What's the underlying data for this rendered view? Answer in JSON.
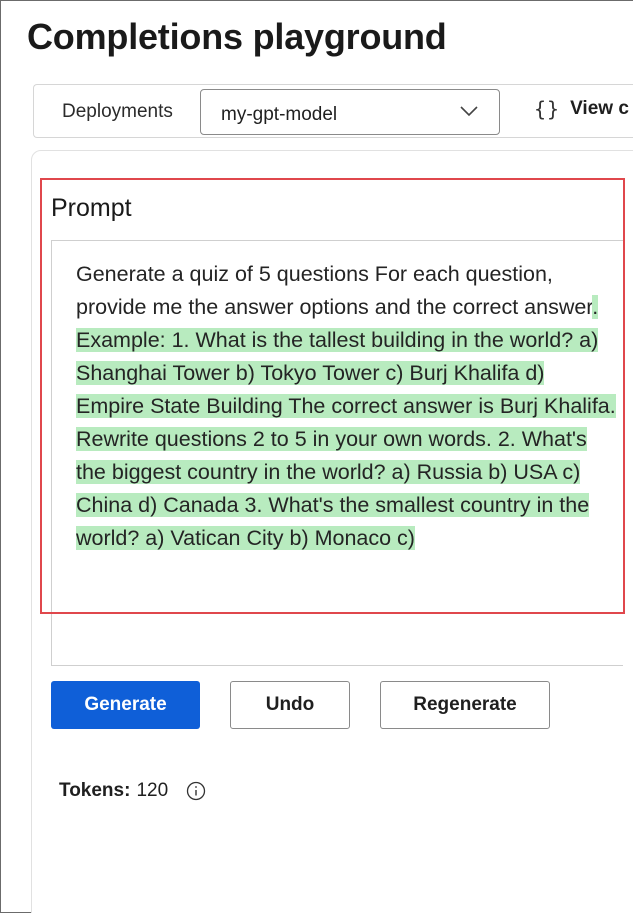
{
  "page": {
    "title": "Completions playground"
  },
  "toolbar": {
    "deployments_label": "Deployments",
    "deployment_selected": "my-gpt-model",
    "view_code_label": "View c",
    "view_code_icon": "curly-braces-icon"
  },
  "prompt": {
    "heading": "Prompt",
    "text_plain": "Generate a quiz of 5 questions For each question, provide me the answer options and the correct answer",
    "text_highlighted": ". Example: 1. What is the tallest building in the world? a) Shanghai Tower b) Tokyo Tower c) Burj Khalifa d) Empire State Building The correct answer is Burj Khalifa. Rewrite questions 2 to 5 in your own words. 2. What's the biggest country in the world? a) Russia b) USA c) China d) Canada 3. What's the smallest country in the world? a) Vatican City b) Monaco c)",
    "highlight_color": "#b8ebbf",
    "border_color": "#e0474c"
  },
  "actions": {
    "generate_label": "Generate",
    "undo_label": "Undo",
    "regenerate_label": "Regenerate",
    "primary_color": "#0f5fd8"
  },
  "tokens": {
    "label": "Tokens:",
    "value": "120",
    "icon": "info-icon"
  }
}
